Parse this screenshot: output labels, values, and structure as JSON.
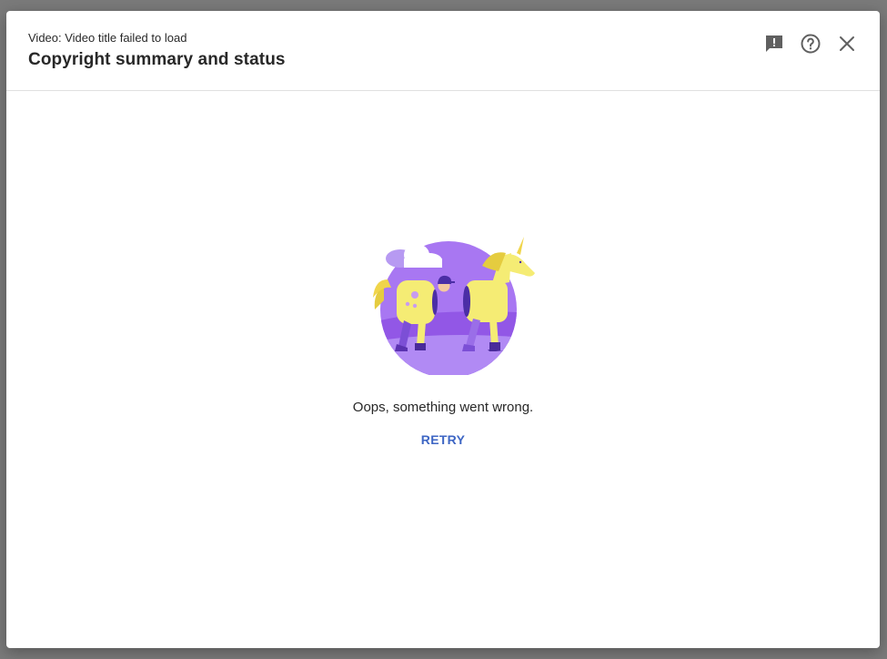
{
  "header": {
    "subtitle": "Video: Video title failed to load",
    "title": "Copyright summary and status"
  },
  "actions": {
    "feedback_icon": "feedback-icon",
    "help_icon": "help-icon",
    "close_icon": "close-icon"
  },
  "content": {
    "error_message": "Oops, something went wrong.",
    "retry_label": "RETRY",
    "illustration": "unicorn-costume-error-illustration"
  },
  "colors": {
    "accent": "#3e66c4",
    "text": "#282828",
    "icon": "#606060",
    "circle": "#a06cf0",
    "unicorn": "#f5ec74"
  }
}
